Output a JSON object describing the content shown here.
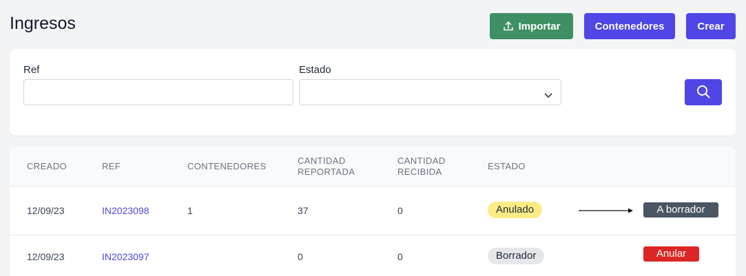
{
  "header": {
    "title": "Ingresos",
    "import_label": "Importar",
    "containers_label": "Contenedores",
    "create_label": "Crear"
  },
  "filters": {
    "ref_label": "Ref",
    "ref_value": "",
    "estado_label": "Estado",
    "estado_value": ""
  },
  "table": {
    "columns": [
      "CREADO",
      "REF",
      "CONTENEDORES",
      "CANTIDAD REPORTADA",
      "CANTIDAD RECIBIDA",
      "ESTADO"
    ],
    "rows": [
      {
        "created": "12/09/23",
        "ref": "IN2023098",
        "containers": "1",
        "reported": "37",
        "received": "0",
        "status": "Anulado",
        "action": "A borrador"
      },
      {
        "created": "12/09/23",
        "ref": "IN2023097",
        "containers": "",
        "reported": "0",
        "received": "0",
        "status": "Borrador",
        "action": "Anular"
      }
    ]
  },
  "colors": {
    "primary": "#4f46e5",
    "import_green": "#3f8f65",
    "anulado_badge": "#fdec86",
    "borrador_badge": "#e5e7eb",
    "danger": "#dc2626",
    "dark_action": "#4b5563"
  },
  "icons": {
    "import": "upload-icon",
    "search": "search-icon",
    "select": "chevron-down-icon"
  }
}
